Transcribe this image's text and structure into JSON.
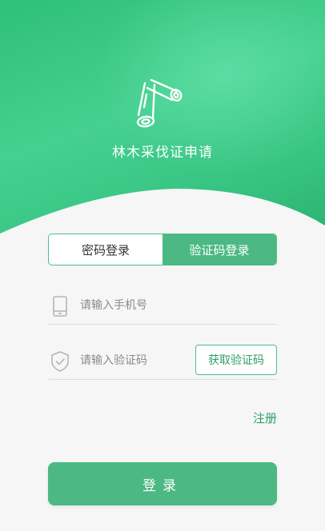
{
  "app": {
    "title": "林木采伐证申请"
  },
  "tabs": [
    {
      "label": "密码登录",
      "active": false
    },
    {
      "label": "验证码登录",
      "active": true
    }
  ],
  "form": {
    "phone_placeholder": "请输入手机号",
    "phone_value": "",
    "code_placeholder": "请输入验证码",
    "code_value": "",
    "get_code_label": "获取验证码",
    "register_label": "注册",
    "login_label": "登录"
  },
  "icons": {
    "logo": "logs-icon",
    "phone": "phone-icon",
    "code": "shield-check-icon"
  },
  "colors": {
    "brand": "#4cb883",
    "header_gradient_start": "#2fbf78",
    "header_gradient_end": "#2bb272",
    "accent_text": "#2e9e69",
    "background": "#f6f6f6"
  }
}
